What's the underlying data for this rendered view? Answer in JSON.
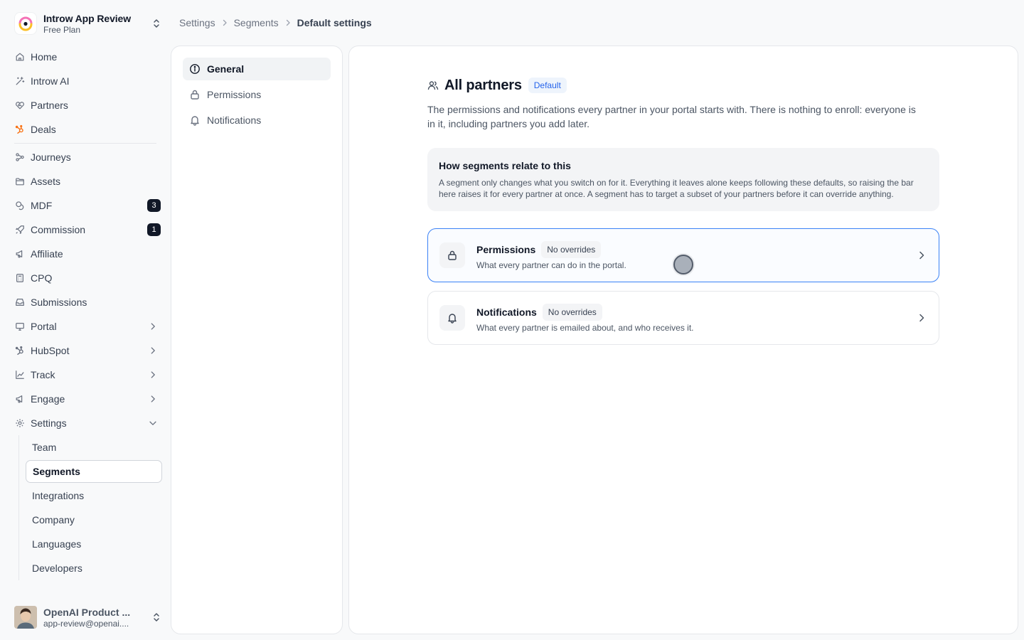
{
  "workspace": {
    "name": "Introw App Review",
    "plan": "Free Plan"
  },
  "nav": {
    "home": "Home",
    "introw_ai": "Introw AI",
    "partners": "Partners",
    "deals": "Deals",
    "journeys": "Journeys",
    "assets": "Assets",
    "mdf": "MDF",
    "mdf_count": "3",
    "commission": "Commission",
    "commission_count": "1",
    "affiliate": "Affiliate",
    "cpq": "CPQ",
    "submissions": "Submissions",
    "portal": "Portal",
    "hubspot": "HubSpot",
    "track": "Track",
    "engage": "Engage",
    "settings": "Settings",
    "settings_sub": {
      "team": "Team",
      "segments": "Segments",
      "integrations": "Integrations",
      "company": "Company",
      "languages": "Languages",
      "developers": "Developers"
    }
  },
  "user": {
    "name": "OpenAI Product ...",
    "email": "app-review@openai...."
  },
  "breadcrumb": {
    "root": "Settings",
    "parent": "Segments",
    "current": "Default settings"
  },
  "tabs": {
    "general": "General",
    "permissions": "Permissions",
    "notifications": "Notifications"
  },
  "main": {
    "title": "All partners",
    "badge": "Default",
    "description": "The permissions and notifications every partner in your portal starts with. There is nothing to enroll: everyone is in it, including partners you add later.",
    "info": {
      "title": "How segments relate to this",
      "text": "A segment only changes what you switch on for it. Everything it leaves alone keeps following these defaults, so raising the bar here raises it for every partner at once. A segment has to target a subset of your partners before it can override anything."
    },
    "cards": [
      {
        "title": "Permissions",
        "badge": "No overrides",
        "subtitle": "What every partner can do in the portal."
      },
      {
        "title": "Notifications",
        "badge": "No overrides",
        "subtitle": "What every partner is emailed about, and who receives it."
      }
    ]
  },
  "colors": {
    "accent": "#3b82f6",
    "badge_dark": "#111827",
    "hubspot_orange": "#f97316",
    "default_badge": "#2563eb"
  },
  "icons": {
    "workspace": "introw-logo",
    "home": "home-icon",
    "introw_ai": "sparkle-icon",
    "partners": "handshake-icon",
    "deals": "hubspot-icon",
    "journeys": "journeys-icon",
    "assets": "folder-icon",
    "mdf": "coins-icon",
    "commission": "rocket-icon",
    "affiliate": "megaphone-icon",
    "cpq": "calculator-icon",
    "submissions": "inbox-icon",
    "portal": "monitor-icon",
    "hubspot": "hubspot-icon",
    "track": "chart-icon",
    "engage": "megaphone-icon",
    "settings": "gear-icon"
  }
}
